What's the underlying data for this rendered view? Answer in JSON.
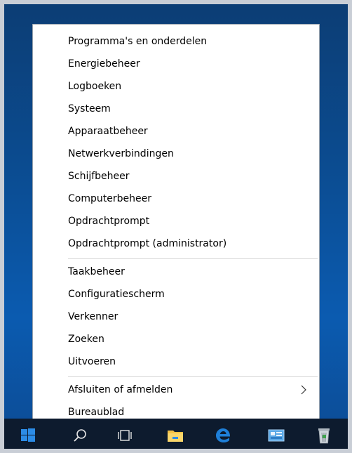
{
  "menu": {
    "group1": [
      {
        "label": "Programma's en onderdelen"
      },
      {
        "label": "Energiebeheer"
      },
      {
        "label": "Logboeken"
      },
      {
        "label": "Systeem"
      },
      {
        "label": "Apparaatbeheer"
      },
      {
        "label": "Netwerkverbindingen"
      },
      {
        "label": "Schijfbeheer"
      },
      {
        "label": "Computerbeheer"
      },
      {
        "label": "Opdrachtprompt"
      },
      {
        "label": "Opdrachtprompt (administrator)"
      }
    ],
    "group2": [
      {
        "label": "Taakbeheer"
      },
      {
        "label": "Configuratiescherm"
      },
      {
        "label": "Verkenner"
      },
      {
        "label": "Zoeken"
      },
      {
        "label": "Uitvoeren"
      }
    ],
    "group3": [
      {
        "label": "Afsluiten of afmelden",
        "submenu_icon": "chevron-right-icon"
      },
      {
        "label": "Bureaublad"
      }
    ]
  },
  "taskbar": {
    "items": [
      {
        "icon": "windows-start-icon"
      },
      {
        "icon": "search-icon"
      },
      {
        "icon": "task-view-icon"
      },
      {
        "icon": "file-explorer-icon"
      },
      {
        "icon": "edge-browser-icon"
      },
      {
        "icon": "control-panel-icon"
      },
      {
        "icon": "recycle-bin-icon"
      }
    ]
  },
  "colors": {
    "menu_bg": "#ffffff",
    "separator": "#d6d6d6",
    "taskbar_bg": "#0d1b2e",
    "desktop_blue": "#0b5bb0",
    "edge_blue": "#1e7fd8",
    "folder_yellow": "#f4c246"
  }
}
